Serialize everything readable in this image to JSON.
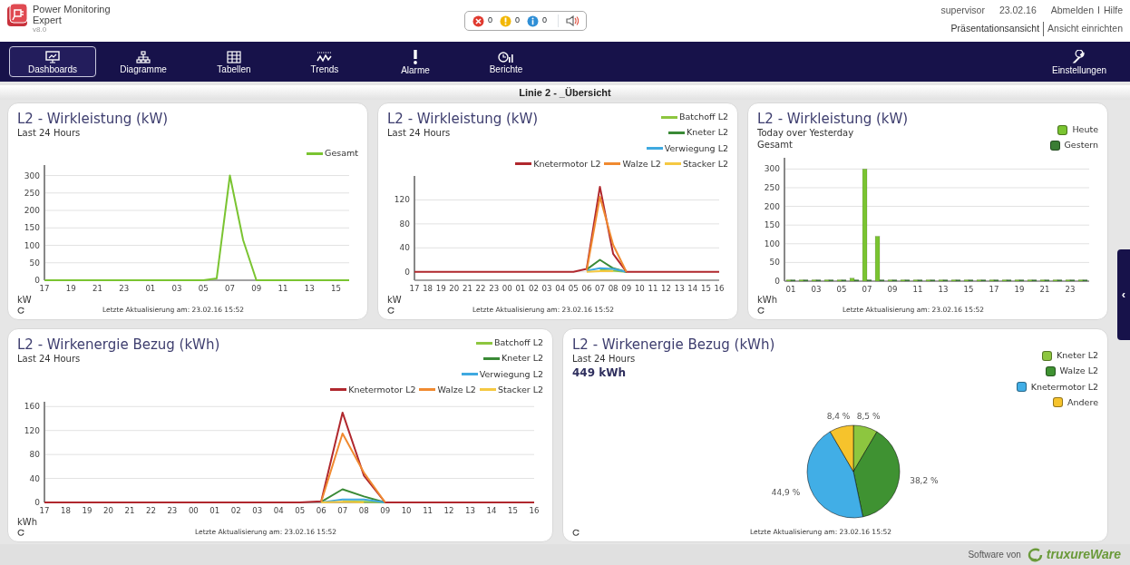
{
  "header": {
    "product": [
      "Power Monitoring",
      "Expert"
    ],
    "version": "v8.0",
    "alarm_counts": [
      {
        "kind": "error",
        "count": "0"
      },
      {
        "kind": "warning",
        "count": "0"
      },
      {
        "kind": "info",
        "count": "0"
      }
    ],
    "user": "supervisor",
    "date": "23.02.16",
    "links": [
      "Abmelden",
      "I",
      "Hilfe"
    ],
    "views": [
      "Präsentationsansicht",
      "Ansicht einrichten"
    ]
  },
  "nav": {
    "items": [
      {
        "kind": "dashboards",
        "label": "Dashboards",
        "selected": true
      },
      {
        "kind": "diagrams",
        "label": "Diagramme",
        "selected": false
      },
      {
        "kind": "tables",
        "label": "Tabellen",
        "selected": false
      },
      {
        "kind": "trends",
        "label": "Trends",
        "selected": false
      },
      {
        "kind": "alarms",
        "label": "Alarme",
        "selected": false
      },
      {
        "kind": "reports",
        "label": "Berichte",
        "selected": false
      }
    ],
    "settings": {
      "label": "Einstellungen"
    }
  },
  "page_title": "Linie 2 - _Übersicht",
  "side_handle": "‹",
  "widgets": [
    {
      "title": "L2 - Wirkleistung (kW)",
      "subtitles": [
        "Last 24 Hours"
      ],
      "updated": "Letzte Aktualisierung am: 23.02.16 15:52",
      "chart_data": {
        "type": "line",
        "ylabel": "kW",
        "grid": true,
        "categories": [
          "17",
          null,
          "19",
          null,
          "21",
          null,
          "23",
          null,
          "01",
          null,
          "03",
          null,
          "05",
          null,
          "07",
          null,
          "09",
          null,
          "11",
          null,
          "13",
          null,
          "15",
          null
        ],
        "ylim": [
          0,
          330
        ],
        "yticks": [
          0,
          50,
          100,
          150,
          200,
          250,
          300
        ],
        "series": [
          {
            "name": "Gesamt",
            "color": "#7ac431",
            "values": [
              0,
              0,
              0,
              0,
              0,
              0,
              0,
              0,
              0,
              0,
              0,
              0,
              0,
              5,
              300,
              115,
              0,
              0,
              0,
              0,
              0,
              0,
              0,
              0
            ]
          }
        ]
      }
    },
    {
      "title": "L2 - Wirkleistung (kW)",
      "subtitles": [
        "Last 24 Hours"
      ],
      "updated": "Letzte Aktualisierung am: 23.02.16 15:52",
      "chart_data": {
        "type": "line",
        "ylabel": "kW",
        "grid": true,
        "categories": [
          "17",
          "18",
          "19",
          "20",
          "21",
          "22",
          "23",
          "00",
          "01",
          "02",
          "03",
          "04",
          "05",
          "06",
          "07",
          "08",
          "09",
          "10",
          "11",
          "12",
          "13",
          "14",
          "15",
          "16"
        ],
        "ylim": [
          -14,
          160
        ],
        "yticks": [
          0,
          40,
          80,
          120
        ],
        "series": [
          {
            "name": "Batchoff L2",
            "color": "#8dc63f",
            "values": [
              null,
              null,
              null,
              null,
              null,
              null,
              null,
              null,
              null,
              null,
              null,
              null,
              null,
              null,
              3,
              2,
              0,
              null,
              null,
              null,
              null,
              null,
              null,
              null
            ]
          },
          {
            "name": "Kneter L2",
            "color": "#3a8a36",
            "values": [
              null,
              null,
              null,
              null,
              null,
              null,
              null,
              null,
              null,
              null,
              null,
              null,
              null,
              4,
              20,
              6,
              0,
              null,
              null,
              null,
              null,
              null,
              null,
              null
            ]
          },
          {
            "name": "Verwiegung L2",
            "color": "#3fa9e0",
            "values": [
              null,
              null,
              null,
              null,
              null,
              null,
              null,
              null,
              null,
              null,
              null,
              null,
              null,
              2,
              6,
              5,
              0,
              null,
              null,
              null,
              null,
              null,
              null,
              null
            ]
          },
          {
            "name": "Knetermotor L2",
            "color": "#b0282e",
            "values": [
              0,
              0,
              0,
              0,
              0,
              0,
              0,
              0,
              0,
              0,
              0,
              0,
              0,
              5,
              142,
              30,
              0,
              0,
              0,
              0,
              0,
              0,
              0,
              0
            ]
          },
          {
            "name": "Walze L2",
            "color": "#f08a30",
            "values": [
              null,
              null,
              null,
              null,
              null,
              null,
              null,
              null,
              null,
              null,
              null,
              null,
              null,
              2,
              125,
              45,
              0,
              null,
              null,
              null,
              null,
              null,
              null,
              null
            ]
          },
          {
            "name": "Stacker L2",
            "color": "#f5c842",
            "values": [
              null,
              null,
              null,
              null,
              null,
              null,
              null,
              null,
              null,
              null,
              null,
              null,
              null,
              0,
              1,
              1,
              null,
              null,
              null,
              null,
              null,
              null,
              null,
              null
            ]
          }
        ]
      }
    },
    {
      "title": "L2 - Wirkleistung (kW)",
      "subtitles": [
        "Today over Yesterday",
        "Gesamt"
      ],
      "updated": "Letzte Aktualisierung am: 23.02.16 15:52",
      "chart_data": {
        "type": "bar",
        "ylabel": "kWh",
        "grid": true,
        "categories": [
          "01",
          null,
          "03",
          null,
          "05",
          null,
          "07",
          null,
          "09",
          null,
          "11",
          null,
          "13",
          null,
          "15",
          null,
          "17",
          null,
          "19",
          null,
          "21",
          null,
          "23",
          null
        ],
        "ylim": [
          0,
          330
        ],
        "yticks": [
          0,
          50,
          100,
          150,
          200,
          250,
          300
        ],
        "series": [
          {
            "name": "Heute",
            "color": "#7ac431",
            "values": [
              0,
              0,
              0,
              0,
              0,
              8,
              300,
              120,
              0,
              0,
              0,
              0,
              0,
              0,
              0,
              0,
              0,
              0,
              0,
              0,
              0,
              0,
              0,
              0
            ]
          },
          {
            "name": "Gestern",
            "color": "#3a7d34",
            "values": [
              0,
              0,
              0,
              0,
              0,
              0,
              0,
              0,
              0,
              0,
              0,
              0,
              0,
              0,
              0,
              0,
              0,
              0,
              0,
              0,
              0,
              0,
              0,
              0
            ]
          }
        ]
      }
    },
    {
      "title": "L2 - Wirkenergie Bezug (kWh)",
      "subtitles": [
        "Last 24 Hours"
      ],
      "updated": "Letzte Aktualisierung am: 23.02.16 15:52",
      "chart_data": {
        "type": "line",
        "ylabel": "kWh",
        "grid": true,
        "categories": [
          "17",
          "18",
          "19",
          "20",
          "21",
          "22",
          "23",
          "00",
          "01",
          "02",
          "03",
          "04",
          "05",
          "06",
          "07",
          "08",
          "09",
          "10",
          "11",
          "12",
          "13",
          "14",
          "15",
          "16"
        ],
        "ylim": [
          0,
          168
        ],
        "yticks": [
          0,
          40,
          80,
          120,
          160
        ],
        "series": [
          {
            "name": "Batchoff L2",
            "color": "#8dc63f",
            "values": [
              null,
              null,
              null,
              null,
              null,
              null,
              null,
              null,
              null,
              null,
              null,
              null,
              null,
              null,
              2,
              1,
              0,
              null,
              null,
              null,
              null,
              null,
              null,
              null
            ]
          },
          {
            "name": "Kneter L2",
            "color": "#3a8a36",
            "values": [
              null,
              null,
              null,
              null,
              null,
              null,
              null,
              null,
              null,
              null,
              null,
              null,
              null,
              1,
              22,
              10,
              0,
              null,
              null,
              null,
              null,
              null,
              null,
              null
            ]
          },
          {
            "name": "Verwiegung L2",
            "color": "#3fa9e0",
            "values": [
              null,
              null,
              null,
              null,
              null,
              null,
              null,
              null,
              null,
              null,
              null,
              null,
              null,
              0,
              5,
              5,
              0,
              null,
              null,
              null,
              null,
              null,
              null,
              null
            ]
          },
          {
            "name": "Knetermotor L2",
            "color": "#b0282e",
            "values": [
              0,
              0,
              0,
              0,
              0,
              0,
              0,
              0,
              0,
              0,
              0,
              0,
              0,
              2,
              150,
              45,
              0,
              0,
              0,
              0,
              0,
              0,
              0,
              0
            ]
          },
          {
            "name": "Walze L2",
            "color": "#f08a30",
            "values": [
              null,
              null,
              null,
              null,
              null,
              null,
              null,
              null,
              null,
              null,
              null,
              null,
              null,
              1,
              115,
              50,
              0,
              null,
              null,
              null,
              null,
              null,
              null,
              null
            ]
          },
          {
            "name": "Stacker L2",
            "color": "#f5c842",
            "values": [
              null,
              null,
              null,
              null,
              null,
              null,
              null,
              null,
              null,
              null,
              null,
              null,
              null,
              0,
              1,
              0,
              null,
              null,
              null,
              null,
              null,
              null,
              null,
              null
            ]
          }
        ]
      }
    },
    {
      "title": "L2 - Wirkenergie Bezug (kWh)",
      "subtitles": [
        "Last 24 Hours"
      ],
      "total": "449 kWh",
      "updated": "Letzte Aktualisierung am: 23.02.16 15:52",
      "chart_data": {
        "type": "pie",
        "categories": [
          "Kneter L2",
          "Walze L2",
          "Knetermotor L2",
          "Andere"
        ],
        "colors": [
          "#8dc63f",
          "#3f9232",
          "#41aee6",
          "#f6c32c"
        ],
        "values": [
          8.5,
          38.2,
          44.9,
          8.4
        ],
        "value_labels": [
          "8,5 %",
          "38,2 %",
          "44,9 %",
          "8,4 %"
        ]
      }
    }
  ],
  "footer": {
    "text": "Software von",
    "brand": "truxureWare"
  }
}
